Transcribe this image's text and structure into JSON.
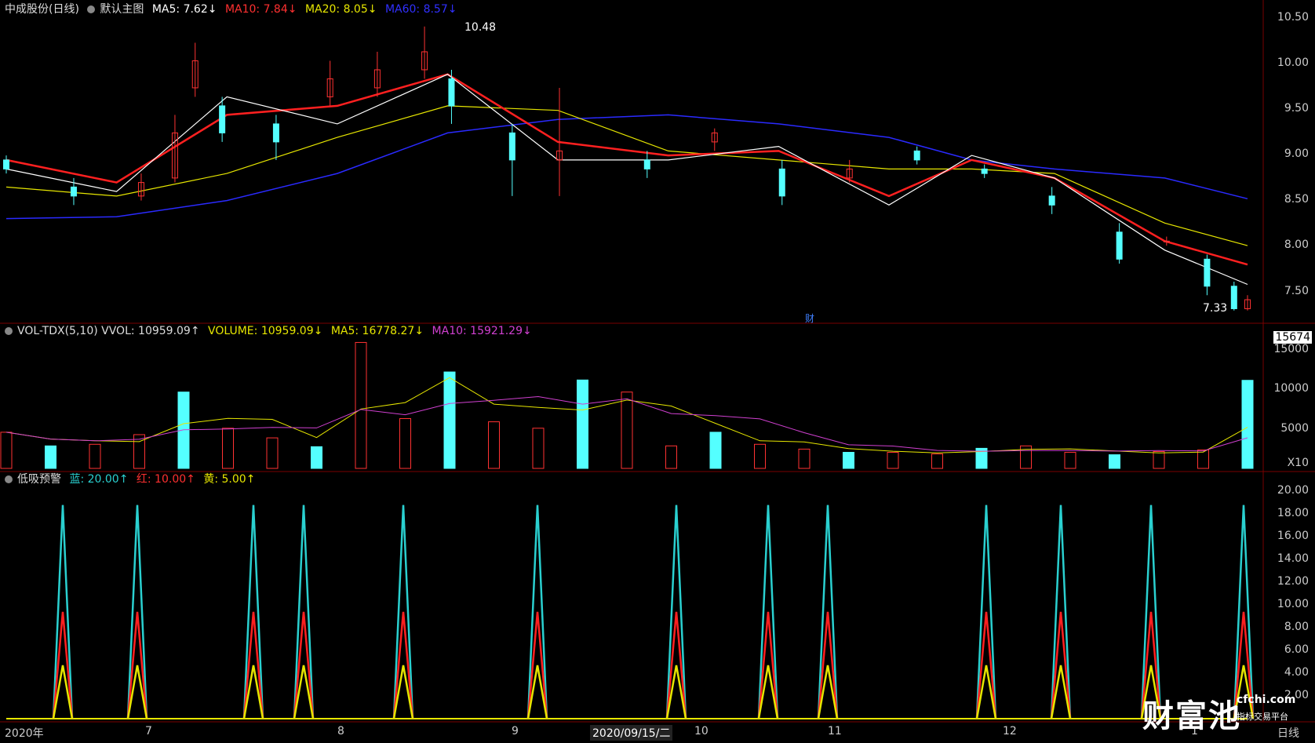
{
  "main_header": {
    "stock": "中成股份(日线)",
    "chart_name": "默认主图",
    "ma5": "MA5: 7.62↓",
    "ma10": "MA10: 7.84↓",
    "ma20": "MA20: 8.05↓",
    "ma60": "MA60: 8.57↓"
  },
  "vol_header": {
    "name": "VOL-TDX(5,10) VVOL: 10959.09↑",
    "volume": "VOLUME: 10959.09↓",
    "ma5": "MA5: 16778.27↓",
    "ma10": "MA10: 15921.29↓"
  },
  "ind_header": {
    "name": "低吸预警",
    "blue": "蓝: 20.00↑",
    "red": "红: 10.00↑",
    "yellow": "黄: 5.00↑"
  },
  "price_axis": [
    "10.50",
    "10.00",
    "9.50",
    "9.00",
    "8.50",
    "8.00",
    "7.50"
  ],
  "vol_axis": [
    "15674",
    "15000",
    "10000",
    "5000",
    "X10"
  ],
  "ind_axis": [
    "20.00",
    "18.00",
    "16.00",
    "14.00",
    "12.00",
    "10.00",
    "8.00",
    "6.00",
    "4.00",
    "2.00"
  ],
  "x_labels": [
    "2020年",
    "7",
    "8",
    "9",
    "2020/09/15/二",
    "10",
    "11",
    "12",
    "1",
    "日线"
  ],
  "annotations": {
    "high": "10.48",
    "low": "7.33",
    "cai": "财"
  },
  "watermark": {
    "name": "财富池",
    "site": "cfchi.com",
    "tagline": "指标交易平台"
  },
  "colors": {
    "up": "#ff3232",
    "down": "#54ffff",
    "ma5": "#ffffff",
    "ma10": "#ff2020",
    "ma20": "#e6e600",
    "ma60": "#2a2aff",
    "vma5": "#e6e600",
    "vma10": "#d040d0"
  },
  "chart_data": [
    {
      "type": "line",
      "title": "中成股份(日线)",
      "series": [
        {
          "name": "MA60",
          "x": [
            0,
            20,
            40,
            60,
            80,
            100,
            120,
            140,
            160,
            175,
            190,
            210,
            225
          ],
          "values": [
            8.35,
            8.37,
            8.55,
            8.85,
            9.3,
            9.45,
            9.5,
            9.4,
            9.25,
            9.0,
            8.9,
            8.8,
            8.57
          ]
        },
        {
          "name": "MA20",
          "x": [
            0,
            20,
            40,
            60,
            80,
            100,
            120,
            140,
            160,
            175,
            190,
            210,
            225
          ],
          "values": [
            8.7,
            8.6,
            8.85,
            9.25,
            9.6,
            9.55,
            9.1,
            9.0,
            8.9,
            8.9,
            8.85,
            8.3,
            8.05
          ]
        },
        {
          "name": "MA10",
          "x": [
            0,
            20,
            40,
            60,
            80,
            100,
            120,
            140,
            160,
            175,
            190,
            210,
            225
          ],
          "values": [
            9.0,
            8.75,
            9.5,
            9.6,
            9.95,
            9.2,
            9.05,
            9.1,
            8.6,
            9.0,
            8.8,
            8.1,
            7.84
          ]
        },
        {
          "name": "MA5",
          "x": [
            0,
            20,
            40,
            60,
            80,
            100,
            120,
            140,
            160,
            175,
            190,
            210,
            225
          ],
          "values": [
            8.9,
            8.65,
            9.7,
            9.4,
            9.95,
            9.0,
            9.0,
            9.15,
            8.5,
            9.05,
            8.8,
            8.0,
            7.62
          ]
        }
      ],
      "ylim": [
        7.25,
        10.6
      ],
      "candles": [
        {
          "x": 0,
          "o": 9.0,
          "c": 8.9,
          "h": 9.05,
          "l": 8.85
        },
        {
          "x": 10,
          "o": 8.7,
          "c": 8.6,
          "h": 8.8,
          "l": 8.5
        },
        {
          "x": 20,
          "o": 8.6,
          "c": 8.75,
          "h": 8.85,
          "l": 8.55
        },
        {
          "x": 25,
          "o": 8.8,
          "c": 9.3,
          "h": 9.5,
          "l": 8.75
        },
        {
          "x": 28,
          "o": 9.8,
          "c": 10.1,
          "h": 10.3,
          "l": 9.7
        },
        {
          "x": 32,
          "o": 9.6,
          "c": 9.3,
          "h": 9.7,
          "l": 9.2
        },
        {
          "x": 40,
          "o": 9.4,
          "c": 9.2,
          "h": 9.5,
          "l": 9.0
        },
        {
          "x": 48,
          "o": 9.7,
          "c": 9.9,
          "h": 10.1,
          "l": 9.6
        },
        {
          "x": 55,
          "o": 9.8,
          "c": 10.0,
          "h": 10.2,
          "l": 9.7
        },
        {
          "x": 62,
          "o": 10.0,
          "c": 10.2,
          "h": 10.48,
          "l": 9.9
        },
        {
          "x": 66,
          "o": 9.9,
          "c": 9.6,
          "h": 10.0,
          "l": 9.4
        },
        {
          "x": 75,
          "o": 9.3,
          "c": 9.0,
          "h": 9.4,
          "l": 8.6
        },
        {
          "x": 82,
          "o": 9.0,
          "c": 9.1,
          "h": 9.8,
          "l": 8.6
        },
        {
          "x": 95,
          "o": 9.0,
          "c": 8.9,
          "h": 9.1,
          "l": 8.8
        },
        {
          "x": 105,
          "o": 9.2,
          "c": 9.3,
          "h": 9.35,
          "l": 9.1
        },
        {
          "x": 115,
          "o": 8.9,
          "c": 8.6,
          "h": 9.0,
          "l": 8.5
        },
        {
          "x": 125,
          "o": 8.8,
          "c": 8.9,
          "h": 9.0,
          "l": 8.75
        },
        {
          "x": 135,
          "o": 9.1,
          "c": 9.0,
          "h": 9.15,
          "l": 8.95
        },
        {
          "x": 145,
          "o": 8.9,
          "c": 8.85,
          "h": 8.95,
          "l": 8.8
        },
        {
          "x": 155,
          "o": 8.6,
          "c": 8.5,
          "h": 8.7,
          "l": 8.4
        },
        {
          "x": 165,
          "o": 8.2,
          "c": 7.9,
          "h": 8.3,
          "l": 7.85
        },
        {
          "x": 172,
          "o": 8.1,
          "c": 8.1,
          "h": 8.15,
          "l": 8.05
        },
        {
          "x": 178,
          "o": 7.9,
          "c": 7.6,
          "h": 7.95,
          "l": 7.5
        },
        {
          "x": 182,
          "o": 7.6,
          "c": 7.35,
          "h": 7.65,
          "l": 7.33
        },
        {
          "x": 184,
          "o": 7.35,
          "c": 7.45,
          "h": 7.5,
          "l": 7.33
        }
      ]
    },
    {
      "type": "bar",
      "title": "VOL-TDX(5,10)",
      "series": [
        {
          "name": "VOLUME",
          "values": [
            4500,
            2800,
            3000,
            4200,
            9500,
            5000,
            3800,
            2700,
            15674,
            6200,
            12000,
            5800,
            5000,
            11000,
            9500,
            2800,
            4500,
            3000,
            2400,
            2000,
            2000,
            1800,
            2500,
            2800,
            2000,
            1700,
            2100,
            2300,
            10959
          ]
        }
      ],
      "ylim": [
        0,
        16500
      ]
    },
    {
      "type": "line",
      "title": "低吸预警",
      "series": [
        {
          "name": "蓝",
          "values": [
            20,
            20,
            20,
            20,
            20,
            20,
            20,
            20,
            20,
            20,
            20,
            20,
            20,
            20,
            20
          ]
        },
        {
          "name": "红",
          "values": [
            10,
            10,
            10,
            10,
            10,
            10,
            10,
            10,
            10,
            10,
            10,
            10,
            10,
            10,
            10
          ]
        },
        {
          "name": "黄",
          "values": [
            5,
            5,
            5,
            5,
            5,
            5,
            5,
            5,
            5,
            5,
            5,
            5,
            5,
            5,
            5
          ]
        }
      ],
      "spike_x": [
        80,
        175,
        323,
        387,
        514,
        685,
        862,
        979,
        1055,
        1257,
        1352,
        1467,
        1585
      ],
      "ylim": [
        0,
        21
      ]
    }
  ]
}
